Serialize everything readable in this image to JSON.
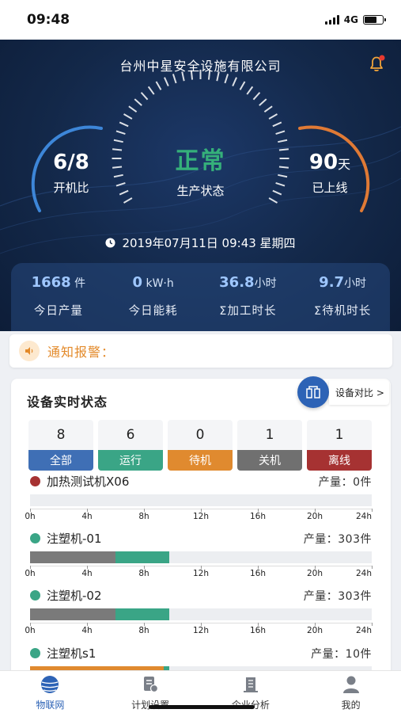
{
  "status_bar": {
    "time": "09:48",
    "network": "4G"
  },
  "header": {
    "company": "台州中星安全设施有限公司"
  },
  "dashboard": {
    "left": {
      "value": "6/8",
      "label": "开机比"
    },
    "center": {
      "value": "正常",
      "label": "生产状态"
    },
    "right": {
      "value": "90",
      "unit": "天",
      "label": "已上线"
    },
    "datetime": "2019年07月11日 09:43 星期四"
  },
  "kpis": [
    {
      "value": "1668",
      "unit": " 件",
      "label": "今日产量"
    },
    {
      "value": "0",
      "unit": " kW·h",
      "label": "今日能耗"
    },
    {
      "value": "36.8",
      "unit": "小时",
      "label": "Σ加工时长"
    },
    {
      "value": "9.7",
      "unit": "小时",
      "label": "Σ待机时长"
    }
  ],
  "notice": {
    "label": "通知报警："
  },
  "devices": {
    "title": "设备实时状态",
    "compare_label": "设备对比 >",
    "counts": [
      {
        "n": "8",
        "label": "全部",
        "color": "#3f6fb5"
      },
      {
        "n": "6",
        "label": "运行",
        "color": "#3aa586"
      },
      {
        "n": "0",
        "label": "待机",
        "color": "#e08a2f"
      },
      {
        "n": "1",
        "label": "关机",
        "color": "#707070"
      },
      {
        "n": "1",
        "label": "离线",
        "color": "#a63232"
      }
    ],
    "ticks": [
      "0h",
      "4h",
      "8h",
      "12h",
      "16h",
      "20h",
      "24h"
    ],
    "machines": [
      {
        "name": "加热测试机X06",
        "status_color": "#a63232",
        "output": "产量：0件",
        "segments": []
      },
      {
        "name": "注塑机-01",
        "status_color": "#3aa586",
        "output": "产量：303件",
        "segments": [
          {
            "from": 0,
            "to": 6.0,
            "color": "#7a7a7a"
          },
          {
            "from": 6.0,
            "to": 9.8,
            "color": "#3aa586"
          }
        ]
      },
      {
        "name": "注塑机-02",
        "status_color": "#3aa586",
        "output": "产量：303件",
        "segments": [
          {
            "from": 0,
            "to": 6.0,
            "color": "#7a7a7a"
          },
          {
            "from": 6.0,
            "to": 9.8,
            "color": "#3aa586"
          }
        ]
      },
      {
        "name": "注塑机s1",
        "status_color": "#3aa586",
        "output": "产量：10件",
        "segments": [
          {
            "from": 0,
            "to": 9.4,
            "color": "#e08a2f"
          },
          {
            "from": 9.4,
            "to": 9.8,
            "color": "#3aa586"
          }
        ]
      }
    ]
  },
  "nav": [
    {
      "label": "物联网",
      "icon": "globe-icon",
      "active": true
    },
    {
      "label": "计划设置",
      "icon": "plan-icon",
      "active": false
    },
    {
      "label": "企业分析",
      "icon": "building-icon",
      "active": false
    },
    {
      "label": "我的",
      "icon": "user-icon",
      "active": false
    }
  ]
}
